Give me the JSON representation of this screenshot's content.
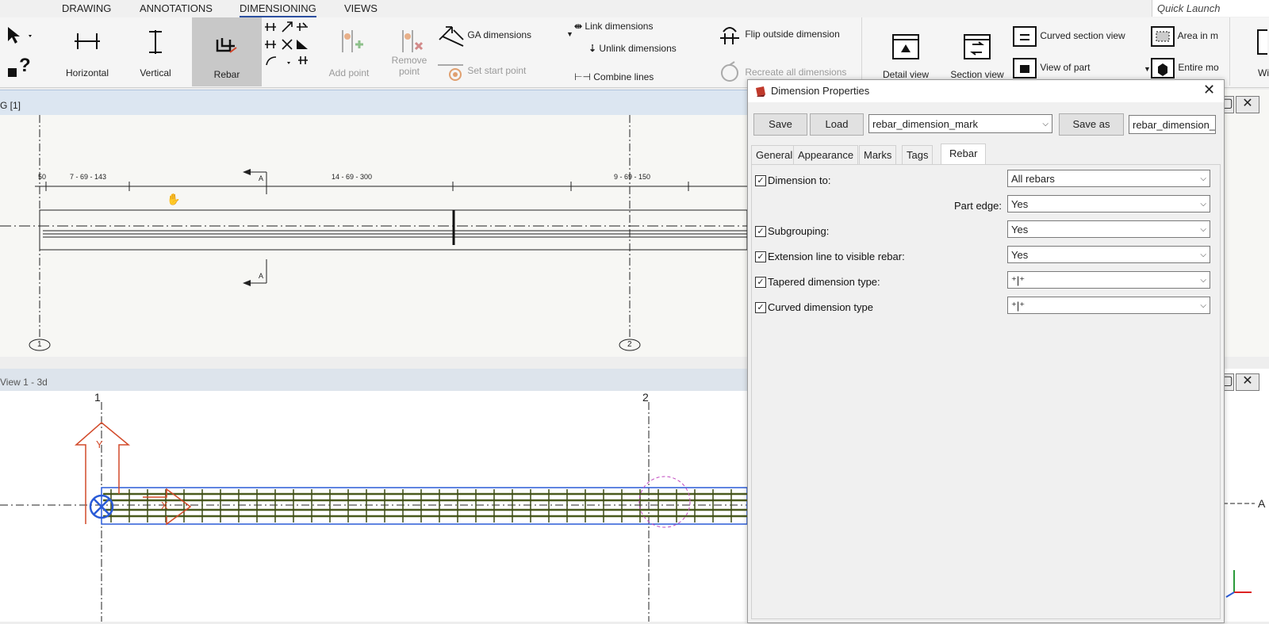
{
  "ribbon_tabs": [
    "DRAWING",
    "ANNOTATIONS",
    "DIMENSIONING",
    "VIEWS"
  ],
  "quick_launch": "Quick Launch",
  "ribbon": {
    "horizontal": "Horizontal",
    "vertical": "Vertical",
    "rebar": "Rebar",
    "add_point": "Add point",
    "remove_point_1": "Remove",
    "remove_point_2": "point",
    "ga_dimensions": "GA dimensions",
    "set_start_point": "Set start point",
    "link_dimensions": "Link dimensions",
    "unlink_dimensions": "Unlink dimensions",
    "combine_lines": "Combine lines",
    "flip_outside_dimension": "Flip outside dimension",
    "recreate_all_dimensions": "Recreate all dimensions",
    "detail_view": "Detail view",
    "section_view": "Section view",
    "curved_section_view": "Curved section view",
    "view_of_part": "View of part",
    "area_in": "Area in m",
    "entire": "Entire mo",
    "win": "Wi"
  },
  "top_view": {
    "title": "G  [1]",
    "dims": [
      "50",
      "7 - 69 - 143",
      "14 - 69 - 300",
      "9 - 69 - 150"
    ],
    "section_mark": "A",
    "grid_labels": [
      "1",
      "2"
    ]
  },
  "bottom_view": {
    "title": "View 1 - 3d",
    "grid_labels": [
      "1",
      "2"
    ],
    "axis_y": "Y",
    "axis_x": "X",
    "section_label": "A"
  },
  "dialog": {
    "title": "Dimension Properties",
    "save": "Save",
    "load": "Load",
    "preset": "rebar_dimension_mark",
    "save_as": "Save as",
    "save_as_name": "rebar_dimension_r",
    "tabs": [
      "General",
      "Appearance",
      "Marks",
      "Tags",
      "Rebar"
    ],
    "active_tab": "Rebar",
    "rows": [
      {
        "label": "Dimension to:",
        "checked": true,
        "value": "All rebars"
      },
      {
        "label": "Part edge:",
        "checked": null,
        "value": "Yes"
      },
      {
        "label": "Subgrouping:",
        "checked": true,
        "value": "Yes"
      },
      {
        "label": "Extension line to visible rebar:",
        "checked": true,
        "value": "Yes"
      },
      {
        "label": "Tapered dimension type:",
        "checked": true,
        "value": "⁺|⁺"
      },
      {
        "label": "Curved dimension type",
        "checked": true,
        "value": "⁺|⁺"
      }
    ]
  },
  "colors": {
    "accent": "#2b4fa0",
    "rebar_highlight": "#c8c8c8",
    "axis_red": "#d24a2a",
    "rebar_green": "#4a5a1e",
    "select_blue": "#2a5bd7"
  }
}
